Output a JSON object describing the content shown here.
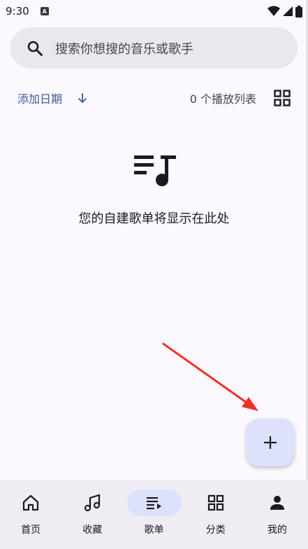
{
  "status_bar": {
    "time": "9:30",
    "notification_glyph": "A",
    "icons": [
      "wifi-icon",
      "signal-icon",
      "battery-icon"
    ]
  },
  "search": {
    "placeholder": "搜索你想搜的音乐或歌手"
  },
  "list_header": {
    "sort_label": "添加日期",
    "count_label": "0 个播放列表"
  },
  "empty_state": {
    "icon": "playlist-music-icon",
    "message": "您的自建歌单将显示在此处"
  },
  "fab": {
    "icon": "add-icon"
  },
  "bottom_nav": {
    "items": [
      {
        "label": "首页",
        "icon": "home-icon",
        "active": false
      },
      {
        "label": "收藏",
        "icon": "music-notes-icon",
        "active": false
      },
      {
        "label": "歌单",
        "icon": "playlist-icon",
        "active": true
      },
      {
        "label": "分类",
        "icon": "grid-icon",
        "active": false
      },
      {
        "label": "我的",
        "icon": "person-icon",
        "active": false
      }
    ]
  },
  "colors": {
    "background": "#fbf8fe",
    "accent": "#3f5b92",
    "active_pill": "#dce2fb",
    "annotation_arrow": "#f0302a"
  }
}
